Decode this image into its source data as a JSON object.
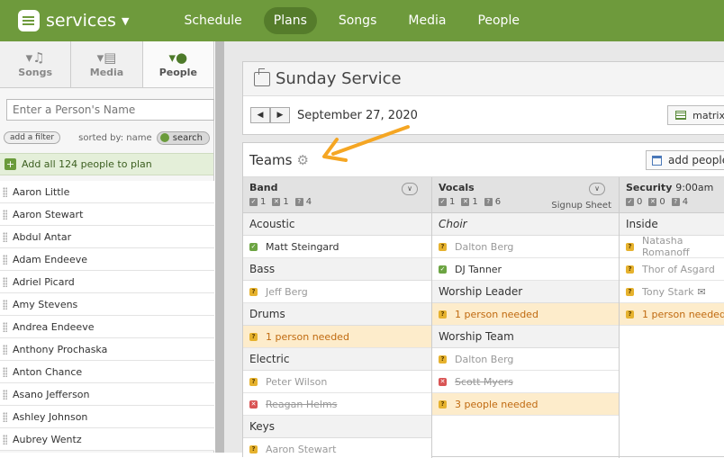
{
  "app": {
    "name": "services"
  },
  "nav": [
    {
      "label": "Schedule",
      "active": false
    },
    {
      "label": "Plans",
      "active": true
    },
    {
      "label": "Songs",
      "active": false
    },
    {
      "label": "Media",
      "active": false
    },
    {
      "label": "People",
      "active": false
    }
  ],
  "sidebar": {
    "tabs": [
      {
        "label": "Songs",
        "icon": "music-note-icon"
      },
      {
        "label": "Media",
        "icon": "film-icon"
      },
      {
        "label": "People",
        "icon": "person-icon"
      }
    ],
    "search_placeholder": "Enter a Person's Name",
    "add_filter_label": "add a filter",
    "sorted_label": "sorted by: name",
    "search_label": "search",
    "add_all_label": "Add all 124 people to plan",
    "people": [
      "Aaron Little",
      "Aaron Stewart",
      "Abdul Antar",
      "Adam Endeeve",
      "Adriel Picard",
      "Amy Stevens",
      "Andrea Endeeve",
      "Anthony Prochaska",
      "Anton Chance",
      "Asano Jefferson",
      "Ashley Johnson",
      "Aubrey Wentz"
    ]
  },
  "plan": {
    "title": "Sunday Service",
    "date": "September 27, 2020",
    "prev_label": "◀",
    "next_label": "▶",
    "matrix_label": "matrix"
  },
  "teams": {
    "title": "Teams",
    "add_people_label": "add people",
    "columns": [
      {
        "name": "Band",
        "time": "",
        "counts": [
          "1",
          "1",
          "4"
        ],
        "signup": "",
        "groups": [
          {
            "name": "Acoustic",
            "rows": [
              {
                "status": "confirmed",
                "text": "Matt Steingard"
              }
            ]
          },
          {
            "name": "Bass",
            "rows": [
              {
                "status": "pending",
                "text": "Jeff Berg"
              }
            ]
          },
          {
            "name": "Drums",
            "rows": [
              {
                "status": "needed",
                "text": "1 person needed"
              }
            ]
          },
          {
            "name": "Electric",
            "rows": [
              {
                "status": "pending",
                "text": "Peter Wilson"
              },
              {
                "status": "declined",
                "text": "Reagan Helms"
              }
            ]
          },
          {
            "name": "Keys",
            "rows": [
              {
                "status": "pending",
                "text": "Aaron Stewart"
              }
            ]
          }
        ]
      },
      {
        "name": "Vocals",
        "time": "",
        "counts": [
          "1",
          "1",
          "6"
        ],
        "signup": "Signup Sheet",
        "groups": [
          {
            "name": "Choir",
            "italic": true,
            "rows": [
              {
                "status": "pending",
                "text": "Dalton Berg"
              },
              {
                "status": "confirmed",
                "text": "DJ Tanner"
              }
            ]
          },
          {
            "name": "Worship Leader",
            "rows": [
              {
                "status": "needed",
                "text": "1 person needed"
              }
            ]
          },
          {
            "name": "Worship Team",
            "rows": [
              {
                "status": "pending",
                "text": "Dalton Berg"
              },
              {
                "status": "declined",
                "text": "Scott Myers"
              },
              {
                "status": "needed",
                "text": "3 people needed"
              }
            ]
          }
        ]
      },
      {
        "name": "Security",
        "time": "9:00am",
        "counts": [
          "0",
          "0",
          "4"
        ],
        "signup": "",
        "groups": [
          {
            "name": "Inside",
            "rows": [
              {
                "status": "pending",
                "text": "Natasha Romanoff"
              },
              {
                "status": "pending",
                "text": "Thor of Asgard"
              },
              {
                "status": "pending",
                "text": "Tony Stark",
                "mail": true
              },
              {
                "status": "needed",
                "text": "1 person needed"
              }
            ]
          }
        ]
      }
    ]
  },
  "colors": {
    "nav_green": "#6e9a3c",
    "nav_active": "#557c2b",
    "arrow": "#f5a623",
    "needed_bg": "#fdeccb",
    "confirmed": "#6ca442",
    "declined": "#d95454",
    "pending": "#e6b22e"
  }
}
